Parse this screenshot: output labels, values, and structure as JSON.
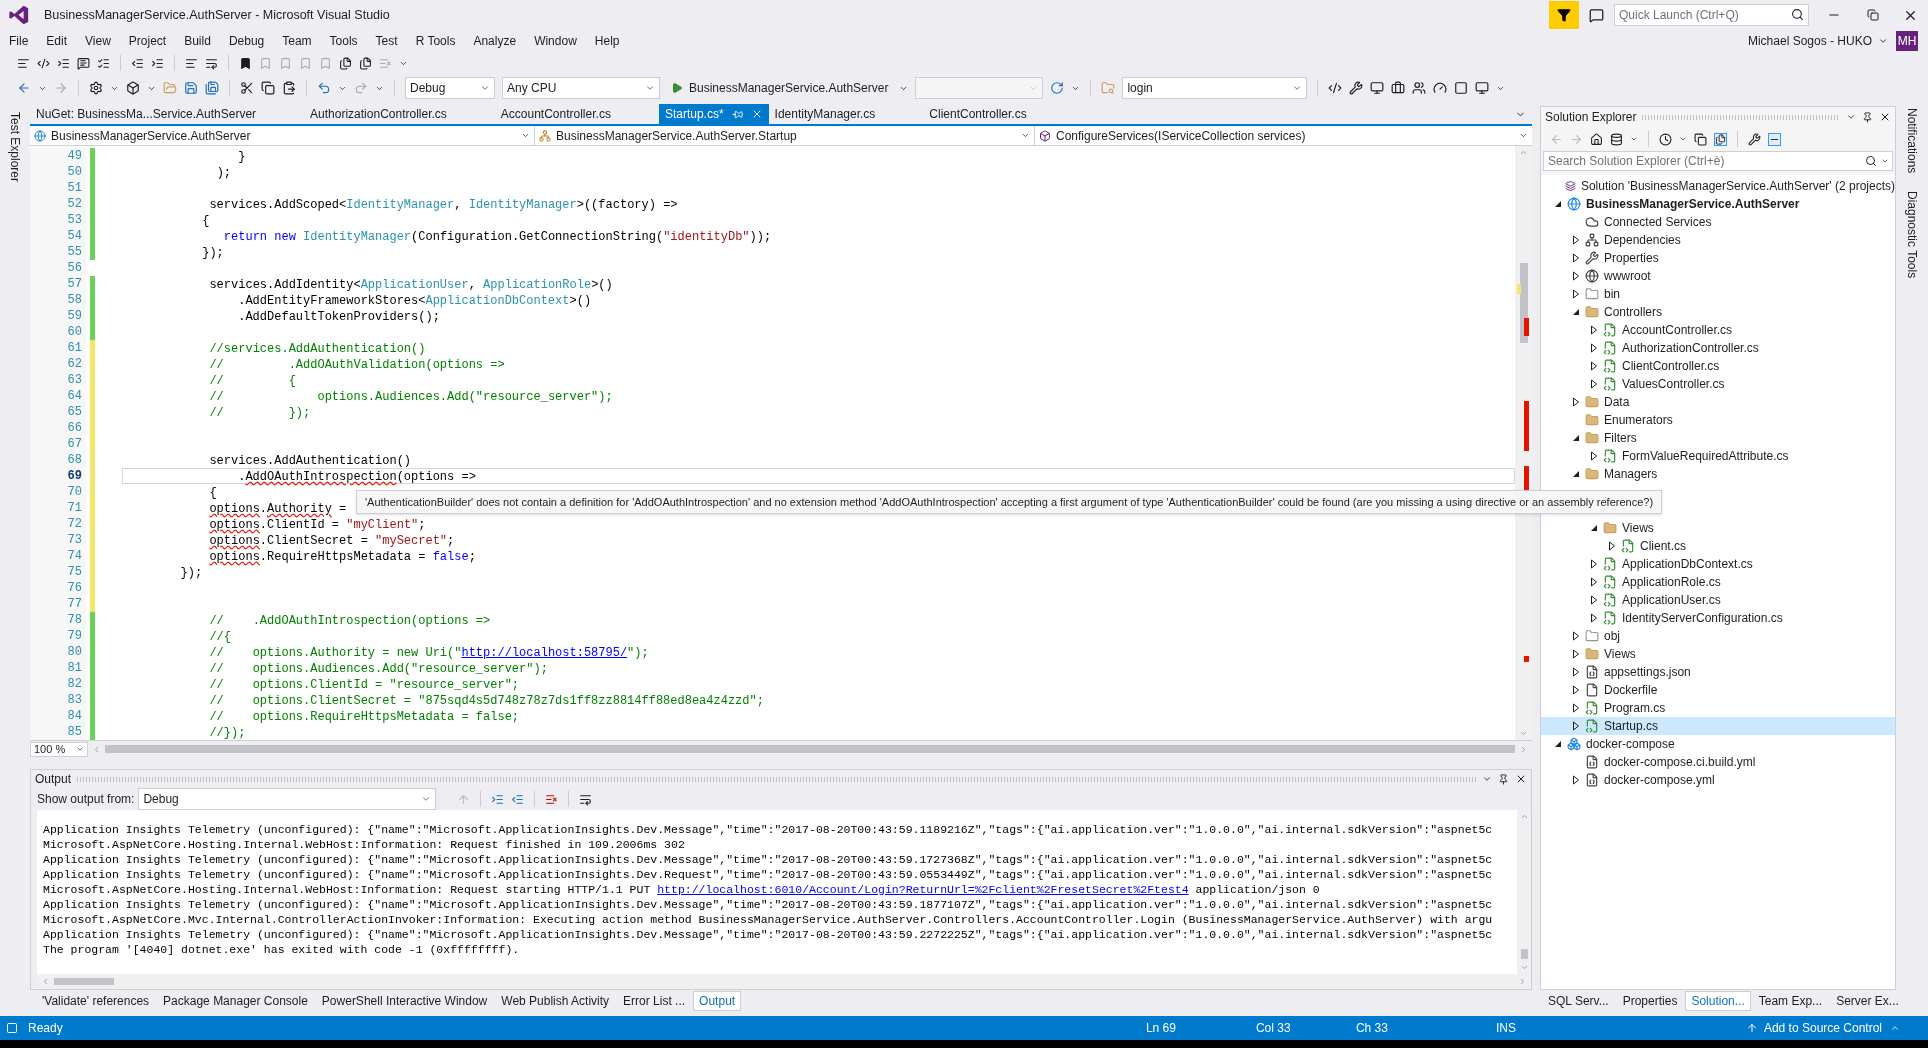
{
  "window": {
    "title": "BusinessManagerService.AuthServer - Microsoft Visual Studio",
    "quick_launch": {
      "placeholder": "Quick Launch (Ctrl+Q)"
    },
    "user": "Michael Sogos - HUKO",
    "avatar": "MH"
  },
  "menu": [
    "File",
    "Edit",
    "View",
    "Project",
    "Build",
    "Debug",
    "Team",
    "Tools",
    "Test",
    "R Tools",
    "Analyze",
    "Window",
    "Help"
  ],
  "toolbar": {
    "configuration": "Debug",
    "platform": "Any CPU",
    "start": "BusinessManagerService.AuthServer",
    "find": "login"
  },
  "left_strip": [
    "Test Explorer"
  ],
  "right_strip": [
    "Notifications",
    "Diagnostic Tools"
  ],
  "document_tabs": [
    {
      "label": "NuGet: BusinessMa...Service.AuthServer",
      "selected": false
    },
    {
      "label": "AuthorizationController.cs",
      "selected": false
    },
    {
      "label": "AccountController.cs",
      "selected": false
    },
    {
      "label": "Startup.cs*",
      "selected": true
    },
    {
      "label": "IdentityManager.cs",
      "selected": false
    },
    {
      "label": "ClientController.cs",
      "selected": false
    }
  ],
  "navigation": {
    "project": "BusinessManagerService.AuthServer",
    "type": "BusinessManagerService.AuthServer.Startup",
    "member": "ConfigureServices(IServiceCollection services)"
  },
  "editor": {
    "zoom": "100 %",
    "tooltip": "'AuthenticationBuilder' does not contain a definition for 'AddOAuthIntrospection' and no extension method 'AddOAuthIntrospection' accepting a first argument of type 'AuthenticationBuilder' could be found (are you missing a using directive or an assembly reference?)",
    "lines": [
      {
        "number": "49",
        "color": "#6ad15b",
        "current": false,
        "segments": [
          {
            "text": "                }",
            "kind": "plain"
          }
        ]
      },
      {
        "number": "50",
        "color": "#6ad15b",
        "current": false,
        "segments": [
          {
            "text": "             );",
            "kind": "plain"
          }
        ]
      },
      {
        "number": "51",
        "color": "#6ad15b",
        "current": false
      },
      {
        "number": "52",
        "color": "#6ad15b",
        "current": false,
        "segments": [
          {
            "text": "            services.AddScoped<",
            "kind": "plain"
          },
          {
            "text": "IdentityManager",
            "kind": "type"
          },
          {
            "text": ", ",
            "kind": "plain"
          },
          {
            "text": "IdentityManager",
            "kind": "type"
          },
          {
            "text": ">((factory) =>",
            "kind": "plain"
          }
        ]
      },
      {
        "number": "53",
        "color": "#6ad15b",
        "current": false,
        "segments": [
          {
            "text": "           {",
            "kind": "plain"
          }
        ]
      },
      {
        "number": "54",
        "color": "#6ad15b",
        "current": false,
        "segments": [
          {
            "text": "              return new ",
            "kind": "keyword"
          },
          {
            "text": "IdentityManager",
            "kind": "type"
          },
          {
            "text": "(Configuration.GetConnectionString(",
            "kind": "plain"
          },
          {
            "text": "\"identityDb\"",
            "kind": "string"
          },
          {
            "text": "));",
            "kind": "plain"
          }
        ]
      },
      {
        "number": "55",
        "color": "#6ad15b",
        "current": false,
        "segments": [
          {
            "text": "           });",
            "kind": "plain"
          }
        ]
      },
      {
        "number": "56",
        "current": false
      },
      {
        "number": "57",
        "color": "#6ad15b",
        "current": false,
        "segments": [
          {
            "text": "            services.AddIdentity<",
            "kind": "plain"
          },
          {
            "text": "ApplicationUser",
            "kind": "type"
          },
          {
            "text": ", ",
            "kind": "plain"
          },
          {
            "text": "ApplicationRole",
            "kind": "type"
          },
          {
            "text": ">()",
            "kind": "plain"
          }
        ]
      },
      {
        "number": "58",
        "color": "#6ad15b",
        "current": false,
        "segments": [
          {
            "text": "                .AddEntityFrameworkStores<",
            "kind": "plain"
          },
          {
            "text": "ApplicationDbContext",
            "kind": "type"
          },
          {
            "text": ">()",
            "kind": "plain"
          }
        ]
      },
      {
        "number": "59",
        "color": "#6ad15b",
        "current": false,
        "segments": [
          {
            "text": "                .AddDefaultTokenProviders();",
            "kind": "plain"
          }
        ]
      },
      {
        "number": "60",
        "color": "#6ad15b",
        "current": false
      },
      {
        "number": "61",
        "color": "#f5e66a",
        "current": false,
        "segments": [
          {
            "text": "            //services.AddAuthentication()",
            "kind": "comment"
          }
        ]
      },
      {
        "number": "62",
        "color": "#f5e66a",
        "current": false,
        "segments": [
          {
            "text": "            //         .AddOAuthValidation(options =>",
            "kind": "comment"
          }
        ]
      },
      {
        "number": "63",
        "color": "#f5e66a",
        "current": false,
        "segments": [
          {
            "text": "            //         {",
            "kind": "comment"
          }
        ]
      },
      {
        "number": "64",
        "color": "#f5e66a",
        "current": false,
        "segments": [
          {
            "text": "            //             options.Audiences.Add(\"resource_server\");",
            "kind": "comment"
          }
        ]
      },
      {
        "number": "65",
        "color": "#f5e66a",
        "current": false,
        "segments": [
          {
            "text": "            //         });",
            "kind": "comment"
          }
        ]
      },
      {
        "number": "66",
        "color": "#f5e66a",
        "current": false
      },
      {
        "number": "67",
        "color": "#f5e66a",
        "current": false
      },
      {
        "number": "68",
        "color": "#f5e66a",
        "current": false,
        "segments": [
          {
            "text": "            services.AddAuthentication()",
            "kind": "plain"
          }
        ]
      },
      {
        "number": "69",
        "color": "#f5e66a",
        "current": true,
        "segments": [
          {
            "text": "                .",
            "kind": "plain"
          },
          {
            "text": "AddOAuthIntrospection",
            "kind": "error"
          },
          {
            "text": "(options =>",
            "kind": "plain"
          }
        ]
      },
      {
        "number": "70",
        "color": "#f5e66a",
        "current": false,
        "segments": [
          {
            "text": "            {",
            "kind": "plain"
          }
        ]
      },
      {
        "number": "71",
        "color": "#f5e66a",
        "current": false,
        "segments": [
          {
            "text": "            options",
            "kind": "error"
          },
          {
            "text": ".",
            "kind": "plain"
          },
          {
            "text": "Authority",
            "kind": "error"
          },
          {
            "text": " =",
            "kind": "plain"
          }
        ]
      },
      {
        "number": "72",
        "color": "#f5e66a",
        "current": false,
        "segments": [
          {
            "text": "            options",
            "kind": "error"
          },
          {
            "text": ".ClientId = ",
            "kind": "plain"
          },
          {
            "text": "\"myClient\"",
            "kind": "string"
          },
          {
            "text": ";",
            "kind": "plain"
          }
        ]
      },
      {
        "number": "73",
        "color": "#f5e66a",
        "current": false,
        "segments": [
          {
            "text": "            options",
            "kind": "error"
          },
          {
            "text": ".ClientSecret = ",
            "kind": "plain"
          },
          {
            "text": "\"mySecret\"",
            "kind": "string"
          },
          {
            "text": ";",
            "kind": "plain"
          }
        ]
      },
      {
        "number": "74",
        "color": "#f5e66a",
        "current": false,
        "segments": [
          {
            "text": "            options",
            "kind": "error"
          },
          {
            "text": ".RequireHttpsMetadata = ",
            "kind": "plain"
          },
          {
            "text": "false",
            "kind": "keyword"
          },
          {
            "text": ";",
            "kind": "plain"
          }
        ]
      },
      {
        "number": "75",
        "color": "#f5e66a",
        "current": false,
        "segments": [
          {
            "text": "        });",
            "kind": "plain"
          }
        ]
      },
      {
        "number": "76",
        "color": "#f5e66a",
        "current": false
      },
      {
        "number": "77",
        "color": "#f5e66a",
        "current": false
      },
      {
        "number": "78",
        "color": "#6ad15b",
        "current": false,
        "segments": [
          {
            "text": "            //    .AddOAuthIntrospection(options =>",
            "kind": "comment"
          }
        ]
      },
      {
        "number": "79",
        "color": "#6ad15b",
        "current": false,
        "segments": [
          {
            "text": "            //{",
            "kind": "comment"
          }
        ]
      },
      {
        "number": "80",
        "color": "#6ad15b",
        "current": false,
        "segments": [
          {
            "text": "            //    options.Authority = new Uri(\"",
            "kind": "comment"
          },
          {
            "text": "http://localhost:58795/",
            "kind": "link"
          },
          {
            "text": "\");",
            "kind": "comment"
          }
        ]
      },
      {
        "number": "81",
        "color": "#6ad15b",
        "current": false,
        "segments": [
          {
            "text": "            //    options.Audiences.Add(\"resource_server\");",
            "kind": "comment"
          }
        ]
      },
      {
        "number": "82",
        "color": "#6ad15b",
        "current": false,
        "segments": [
          {
            "text": "            //    options.ClientId = \"resource_server\";",
            "kind": "comment"
          }
        ]
      },
      {
        "number": "83",
        "color": "#6ad15b",
        "current": false,
        "segments": [
          {
            "text": "            //    options.ClientSecret = \"875sqd4s5d748z78z7ds1ff8zz8814ff88ed8ea4z4zzd\";",
            "kind": "comment"
          }
        ]
      },
      {
        "number": "84",
        "color": "#6ad15b",
        "current": false,
        "segments": [
          {
            "text": "            //    options.RequireHttpsMetadata = false;",
            "kind": "comment"
          }
        ]
      },
      {
        "number": "85",
        "color": "#6ad15b",
        "current": false,
        "segments": [
          {
            "text": "            //});",
            "kind": "comment"
          }
        ]
      }
    ]
  },
  "output": {
    "title": "Output",
    "source_label": "Show output from:",
    "source": "Debug",
    "lines": [
      {
        "segments": [
          {
            "text": "Application Insights Telemetry (unconfigured): {\"name\":\"Microsoft.ApplicationInsights.Dev.Message\",\"time\":\"2017-08-20T00:43:59.1189216Z\",\"tags\":{\"ai.application.ver\":\"1.0.0.0\",\"ai.internal.sdkVersion\":\"aspnet5c",
            "kind": "plain"
          }
        ]
      },
      {
        "segments": [
          {
            "text": "Microsoft.AspNetCore.Hosting.Internal.WebHost:Information: Request finished in 109.2006ms 302",
            "kind": "plain"
          }
        ]
      },
      {
        "segments": [
          {
            "text": "Application Insights Telemetry (unconfigured): {\"name\":\"Microsoft.ApplicationInsights.Dev.Message\",\"time\":\"2017-08-20T00:43:59.1727368Z\",\"tags\":{\"ai.application.ver\":\"1.0.0.0\",\"ai.internal.sdkVersion\":\"aspnet5c",
            "kind": "plain"
          }
        ]
      },
      {
        "segments": [
          {
            "text": "Application Insights Telemetry (unconfigured): {\"name\":\"Microsoft.ApplicationInsights.Dev.Request\",\"time\":\"2017-08-20T00:43:59.0553449Z\",\"tags\":{\"ai.application.ver\":\"1.0.0.0\",\"ai.internal.sdkVersion\":\"aspnet5c",
            "kind": "plain"
          }
        ]
      },
      {
        "segments": [
          {
            "text": "Microsoft.AspNetCore.Hosting.Internal.WebHost:Information: Request starting HTTP/1.1 PUT ",
            "kind": "plain"
          },
          {
            "text": "http://localhost:6010/Account/Login?ReturnUrl=%2Fclient%2FresetSecret%2Ftest4",
            "kind": "link"
          },
          {
            "text": " application/json 0",
            "kind": "plain"
          }
        ]
      },
      {
        "segments": [
          {
            "text": "Application Insights Telemetry (unconfigured): {\"name\":\"Microsoft.ApplicationInsights.Dev.Message\",\"time\":\"2017-08-20T00:43:59.1877107Z\",\"tags\":{\"ai.application.ver\":\"1.0.0.0\",\"ai.internal.sdkVersion\":\"aspnet5c",
            "kind": "plain"
          }
        ]
      },
      {
        "segments": [
          {
            "text": "Microsoft.AspNetCore.Mvc.Internal.ControllerActionInvoker:Information: Executing action method BusinessManagerService.AuthServer.Controllers.AccountController.Login (BusinessManagerService.AuthServer) with argu",
            "kind": "plain"
          }
        ]
      },
      {
        "segments": [
          {
            "text": "Application Insights Telemetry (unconfigured): {\"name\":\"Microsoft.ApplicationInsights.Dev.Message\",\"time\":\"2017-08-20T00:43:59.2272225Z\",\"tags\":{\"ai.application.ver\":\"1.0.0.0\",\"ai.internal.sdkVersion\":\"aspnet5c",
            "kind": "plain"
          }
        ]
      },
      {
        "segments": [
          {
            "text": "The program '[4040] dotnet.exe' has exited with code -1 (0xffffffff).",
            "kind": "plain"
          }
        ]
      }
    ]
  },
  "bottom_tabs": [
    {
      "label": "'Validate' references",
      "selected": false
    },
    {
      "label": "Package Manager Console",
      "selected": false
    },
    {
      "label": "PowerShell Interactive Window",
      "selected": false
    },
    {
      "label": "Web Publish Activity",
      "selected": false
    },
    {
      "label": "Error List ...",
      "selected": false
    },
    {
      "label": "Output",
      "selected": true
    }
  ],
  "solution_explorer": {
    "title": "Solution Explorer",
    "search": {
      "placeholder": "Search Solution Explorer (Ctrl+è)"
    },
    "tree": [
      {
        "label": "Solution 'BusinessManagerService.AuthServer' (2 projects)",
        "kind": "solution",
        "selected": false
      },
      {
        "label": "BusinessManagerService.AuthServer",
        "kind": "project",
        "expanded": true,
        "selected": false,
        "children": [
          {
            "label": "Connected Services",
            "kind": "cloud",
            "selected": false
          },
          {
            "label": "Dependencies",
            "kind": "dependencies",
            "expanded": false,
            "selected": false
          },
          {
            "label": "Properties",
            "kind": "wrench",
            "expanded": false,
            "selected": false
          },
          {
            "label": "wwwroot",
            "kind": "globe",
            "expanded": false,
            "selected": false
          },
          {
            "label": "bin",
            "kind": "dotted-folder",
            "expanded": false,
            "selected": false
          },
          {
            "label": "Controllers",
            "kind": "folder",
            "expanded": true,
            "selected": false,
            "children": [
              {
                "label": "AccountController.cs",
                "kind": "csharp",
                "expanded": false,
                "selected": false
              },
              {
                "label": "AuthorizationController.cs",
                "kind": "csharp",
                "expanded": false,
                "selected": false
              },
              {
                "label": "ClientController.cs",
                "kind": "csharp",
                "expanded": false,
                "selected": false
              },
              {
                "label": "ValuesController.cs",
                "kind": "csharp",
                "expanded": false,
                "selected": false
              }
            ]
          },
          {
            "label": "Data",
            "kind": "folder",
            "expanded": false,
            "selected": false
          },
          {
            "label": "Enumerators",
            "kind": "folder",
            "selected": false
          },
          {
            "label": "Filters",
            "kind": "folder",
            "expanded": true,
            "selected": false,
            "children": [
              {
                "label": "FormValueRequiredAttribute.cs",
                "kind": "csharp",
                "expanded": false,
                "selected": false
              }
            ]
          },
          {
            "label": "Managers",
            "kind": "folder",
            "expanded": true,
            "selected": false,
            "children": [
              {
                "kind": "covered"
              }
            ]
          },
          {
            "kind": "covered",
            "children": [
              {
                "label": "Views",
                "kind": "folder",
                "expanded": true,
                "selected": false,
                "children": [
                  {
                    "label": "Client.cs",
                    "kind": "csharp",
                    "expanded": false,
                    "selected": false
                  }
                ]
              },
              {
                "label": "ApplicationDbContext.cs",
                "kind": "csharp",
                "expanded": false,
                "selected": false
              },
              {
                "label": "ApplicationRole.cs",
                "kind": "csharp",
                "expanded": false,
                "selected": false
              },
              {
                "label": "ApplicationUser.cs",
                "kind": "csharp",
                "expanded": false,
                "selected": false
              },
              {
                "label": "IdentityServerConfiguration.cs",
                "kind": "csharp",
                "expanded": false,
                "selected": false
              }
            ]
          },
          {
            "label": "obj",
            "kind": "dotted-folder",
            "expanded": false,
            "selected": false
          },
          {
            "label": "Views",
            "kind": "folder",
            "expanded": false,
            "selected": false
          },
          {
            "label": "appsettings.json",
            "kind": "config",
            "expanded": false,
            "selected": false
          },
          {
            "label": "Dockerfile",
            "kind": "file",
            "expanded": false,
            "selected": false
          },
          {
            "label": "Program.cs",
            "kind": "csharp",
            "expanded": false,
            "selected": false
          },
          {
            "label": "Startup.cs",
            "kind": "csharp",
            "expanded": false,
            "selected": true
          }
        ]
      },
      {
        "label": "docker-compose",
        "kind": "docker",
        "expanded": true,
        "selected": false,
        "children": [
          {
            "label": "docker-compose.ci.build.yml",
            "kind": "config",
            "selected": false
          },
          {
            "label": "docker-compose.yml",
            "kind": "config",
            "expanded": false,
            "selected": false
          }
        ]
      }
    ]
  },
  "side_tabs": [
    {
      "label": "SQL Serv...",
      "selected": false
    },
    {
      "label": "Properties",
      "selected": false
    },
    {
      "label": "Solution...",
      "selected": true
    },
    {
      "label": "Team Exp...",
      "selected": false
    },
    {
      "label": "Server Ex...",
      "selected": false
    }
  ],
  "status_bar": {
    "state": "Ready",
    "line": "Ln 69",
    "column": "Col 33",
    "char": "Ch 33",
    "mode": "INS",
    "source_control": "Add to Source Control"
  }
}
